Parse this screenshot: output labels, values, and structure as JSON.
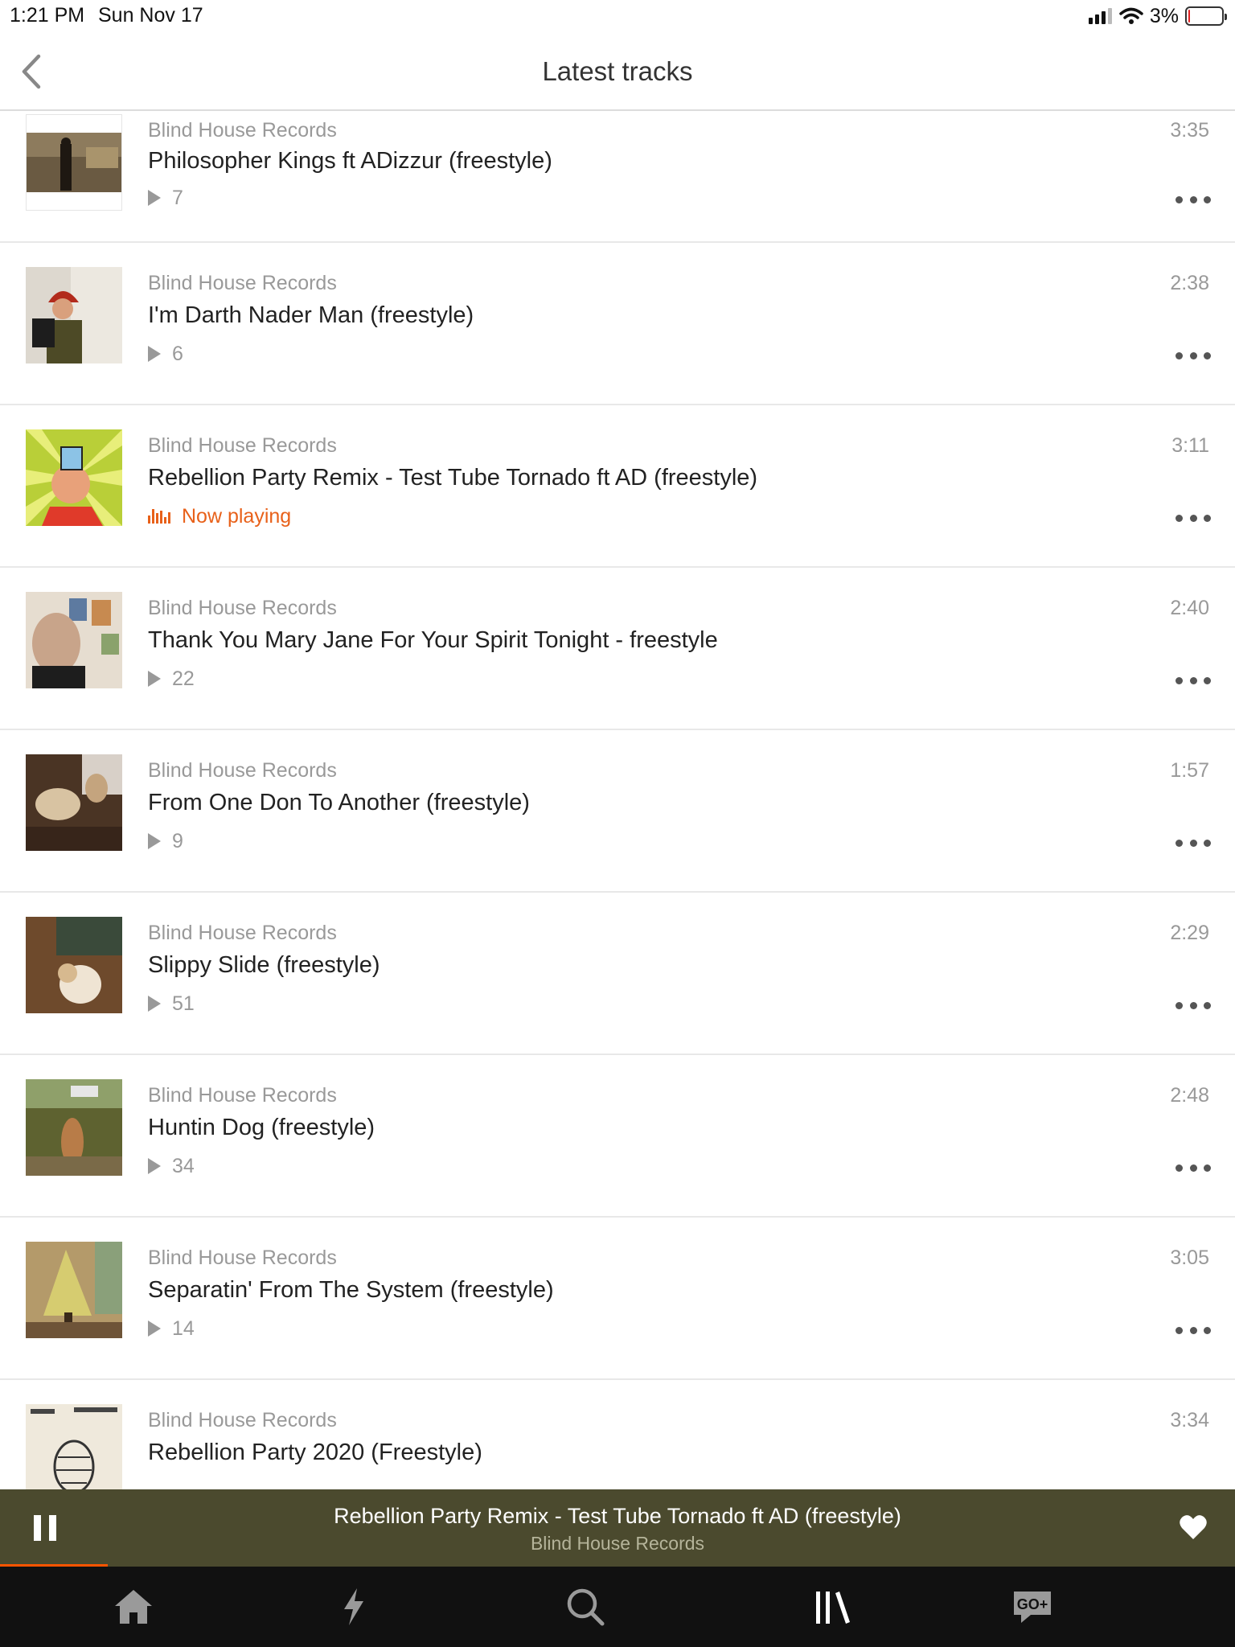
{
  "status_bar": {
    "time": "1:21 PM",
    "date": "Sun Nov 17",
    "battery": "3%",
    "battery_level": 0.03
  },
  "header": {
    "title": "Latest tracks",
    "back_icon": "chevron-left-icon"
  },
  "tracks": [
    {
      "artist": "Blind House Records",
      "title": "Philosopher Kings ft ADizzur (freestyle)",
      "plays": "7",
      "duration": "3:35",
      "now_playing": false
    },
    {
      "artist": "Blind House Records",
      "title": "I'm Darth Nader Man (freestyle)",
      "plays": "6",
      "duration": "2:38",
      "now_playing": false
    },
    {
      "artist": "Blind House Records",
      "title": "Rebellion Party Remix - Test Tube Tornado ft AD (freestyle)",
      "plays": "Now playing",
      "duration": "3:11",
      "now_playing": true
    },
    {
      "artist": "Blind House Records",
      "title": "Thank You Mary Jane For Your Spirit Tonight - freestyle",
      "plays": "22",
      "duration": "2:40",
      "now_playing": false
    },
    {
      "artist": "Blind House Records",
      "title": "From One Don To Another (freestyle)",
      "plays": "9",
      "duration": "1:57",
      "now_playing": false
    },
    {
      "artist": "Blind House Records",
      "title": "Slippy Slide (freestyle)",
      "plays": "51",
      "duration": "2:29",
      "now_playing": false
    },
    {
      "artist": "Blind House Records",
      "title": "Huntin Dog (freestyle)",
      "plays": "34",
      "duration": "2:48",
      "now_playing": false
    },
    {
      "artist": "Blind House Records",
      "title": "Separatin' From The System (freestyle)",
      "plays": "14",
      "duration": "3:05",
      "now_playing": false
    },
    {
      "artist": "Blind House Records",
      "title": "Rebellion Party 2020 (Freestyle)",
      "plays": "",
      "duration": "3:34",
      "now_playing": false
    }
  ],
  "mini_player": {
    "title": "Rebellion Party Remix - Test Tube Tornado ft AD (freestyle)",
    "artist": "Blind House Records",
    "progress": 0.087
  },
  "tab_bar": {
    "tabs": [
      "home-icon",
      "stream-icon",
      "search-icon",
      "library-icon",
      "go-plus-icon"
    ],
    "go_label": "GO+"
  },
  "colors": {
    "accent": "#e8611a",
    "mini_player_bg": "#4b4a2e",
    "tab_bar_bg": "#111111"
  }
}
